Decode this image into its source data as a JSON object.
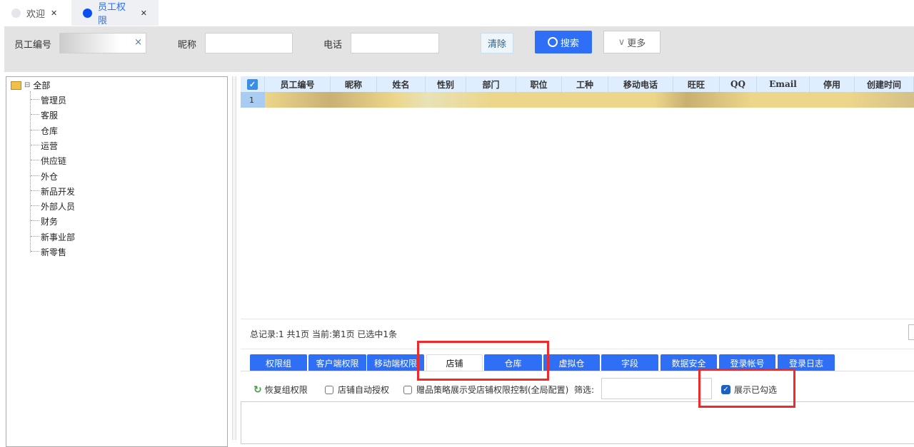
{
  "tabs": [
    {
      "label": "欢迎",
      "close": "✕",
      "active": false
    },
    {
      "label": "员工权限",
      "close": "✕",
      "active": true
    }
  ],
  "filters": {
    "employee_id_label": "员工编号",
    "nickname_label": "昵称",
    "phone_label": "电话",
    "clear": "清除",
    "search": "搜索",
    "more": "更多",
    "clear_x": "×"
  },
  "tree": {
    "root": "全部",
    "items": [
      "管理员",
      "客服",
      "仓库",
      "运营",
      "供应链",
      "外仓",
      "新品开发",
      "外部人员",
      "财务",
      "新事业部",
      "新零售"
    ]
  },
  "grid": {
    "columns": [
      "员工编号",
      "昵称",
      "姓名",
      "性别",
      "部门",
      "职位",
      "工种",
      "移动电话",
      "旺旺",
      "QQ",
      "Email",
      "停用",
      "创建时间"
    ],
    "rows": [
      {
        "index": "1"
      }
    ],
    "footer": "总记录:1 共1页 当前:第1页 已选中1条"
  },
  "panel_tabs": [
    {
      "label": "权限组"
    },
    {
      "label": "客户端权限"
    },
    {
      "label": "移动端权限"
    },
    {
      "label": "店铺",
      "active": true
    },
    {
      "label": "仓库"
    },
    {
      "label": "虚拟仓"
    },
    {
      "label": "字段"
    },
    {
      "label": "数据安全"
    },
    {
      "label": "登录帐号"
    },
    {
      "label": "登录日志"
    }
  ],
  "toolbar": {
    "restore": "恢复组权限",
    "auto_auth": "店铺自动授权",
    "auto_auth_checked": false,
    "gift_policy": "赠品策略展示受店铺权限控制(全局配置)",
    "gift_policy_checked": false,
    "filter_label": "筛选:",
    "show_checked": "展示已勾选",
    "show_checked_checked": true
  },
  "colors": {
    "accent": "#2f6ff5",
    "highlight": "#f02a2a",
    "row_selected": "#ecd68a"
  }
}
